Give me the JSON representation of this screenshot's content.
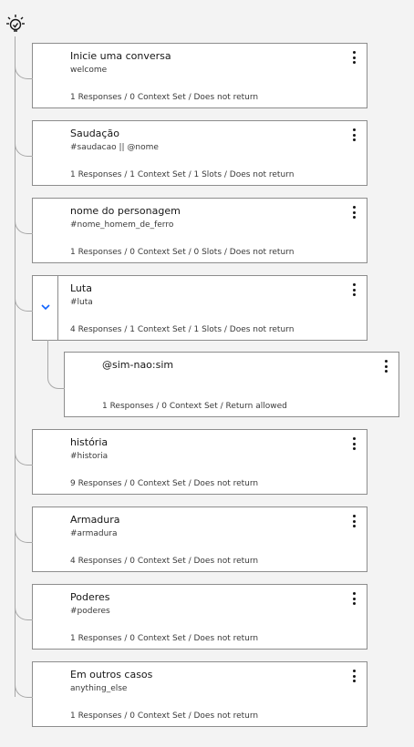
{
  "root_icon": "watson-bulb-icon",
  "nodes": [
    {
      "title": "Inicie uma conversa",
      "condition": "welcome",
      "summary": "1 Responses / 0 Context Set / Does not return"
    },
    {
      "title": "Saudação",
      "condition": "#saudacao || @nome",
      "summary": "1 Responses / 1 Context Set / 1 Slots / Does not return"
    },
    {
      "title": "nome do personagem",
      "condition": "#nome_homem_de_ferro",
      "summary": "1 Responses / 0 Context Set / 0 Slots / Does not return"
    },
    {
      "title": "Luta",
      "condition": "#luta",
      "summary": "4 Responses / 1 Context Set / 1 Slots / Does not return"
    },
    {
      "title": "história",
      "condition": "#historia",
      "summary": "9 Responses / 0 Context Set / Does not return"
    },
    {
      "title": "Armadura",
      "condition": "#armadura",
      "summary": "4 Responses / 0 Context Set / Does not return"
    },
    {
      "title": "Poderes",
      "condition": "#poderes",
      "summary": "1 Responses / 0 Context Set / Does not return"
    },
    {
      "title": "Em outros casos",
      "condition": "anything_else",
      "summary": "1 Responses / 0 Context Set / Does not return"
    }
  ],
  "child": {
    "title": "@sim-nao:sim",
    "summary": "1 Responses / 0 Context Set / Return allowed"
  },
  "colors": {
    "accent": "#0f62fe",
    "border": "#8d8d8d",
    "line": "#a8a8a8"
  }
}
